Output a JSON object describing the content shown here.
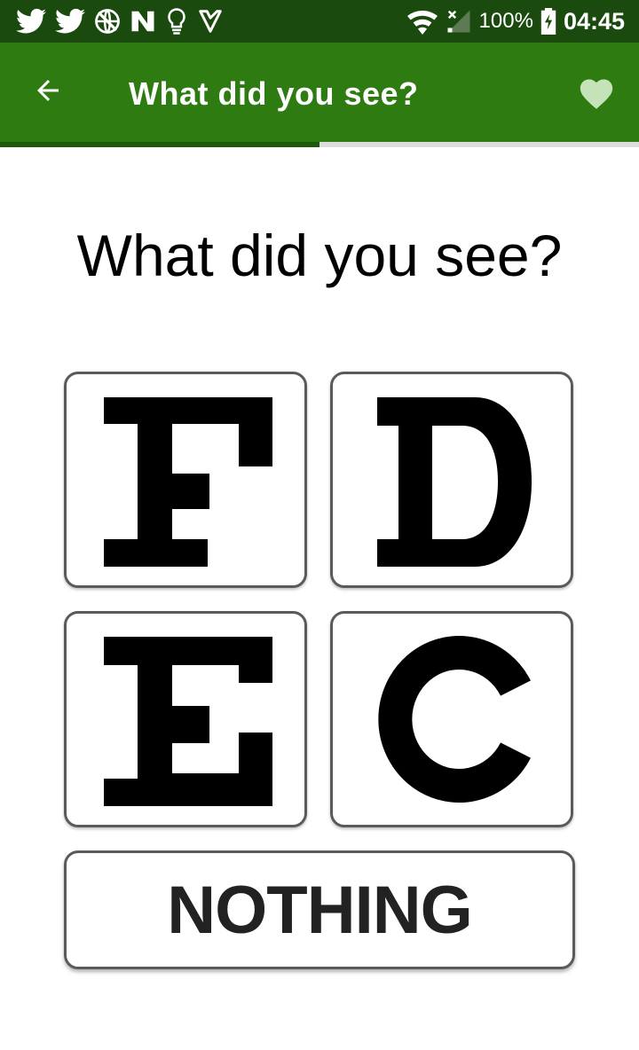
{
  "status_bar": {
    "icons_left": [
      "twitter-icon",
      "twitter-icon",
      "globe-icon",
      "n-app-icon",
      "lightbulb-icon",
      "checkmark-app-icon"
    ],
    "battery_percent": "100%",
    "time": "04:45"
  },
  "app_bar": {
    "title": "What did you see?",
    "back_icon": "arrow-left-icon",
    "favorite_icon": "heart-icon"
  },
  "progress": {
    "fraction": 0.5
  },
  "question": "What did you see?",
  "choices": [
    {
      "letter": "F"
    },
    {
      "letter": "D"
    },
    {
      "letter": "E"
    },
    {
      "letter": "C"
    }
  ],
  "nothing_label": "NOTHING",
  "colors": {
    "status_bar": "#1b4a0f",
    "app_bar": "#2e7b12",
    "progress_fill": "#1f5a0c",
    "progress_track": "#dcdcdc",
    "heart": "#c5e3b8"
  }
}
